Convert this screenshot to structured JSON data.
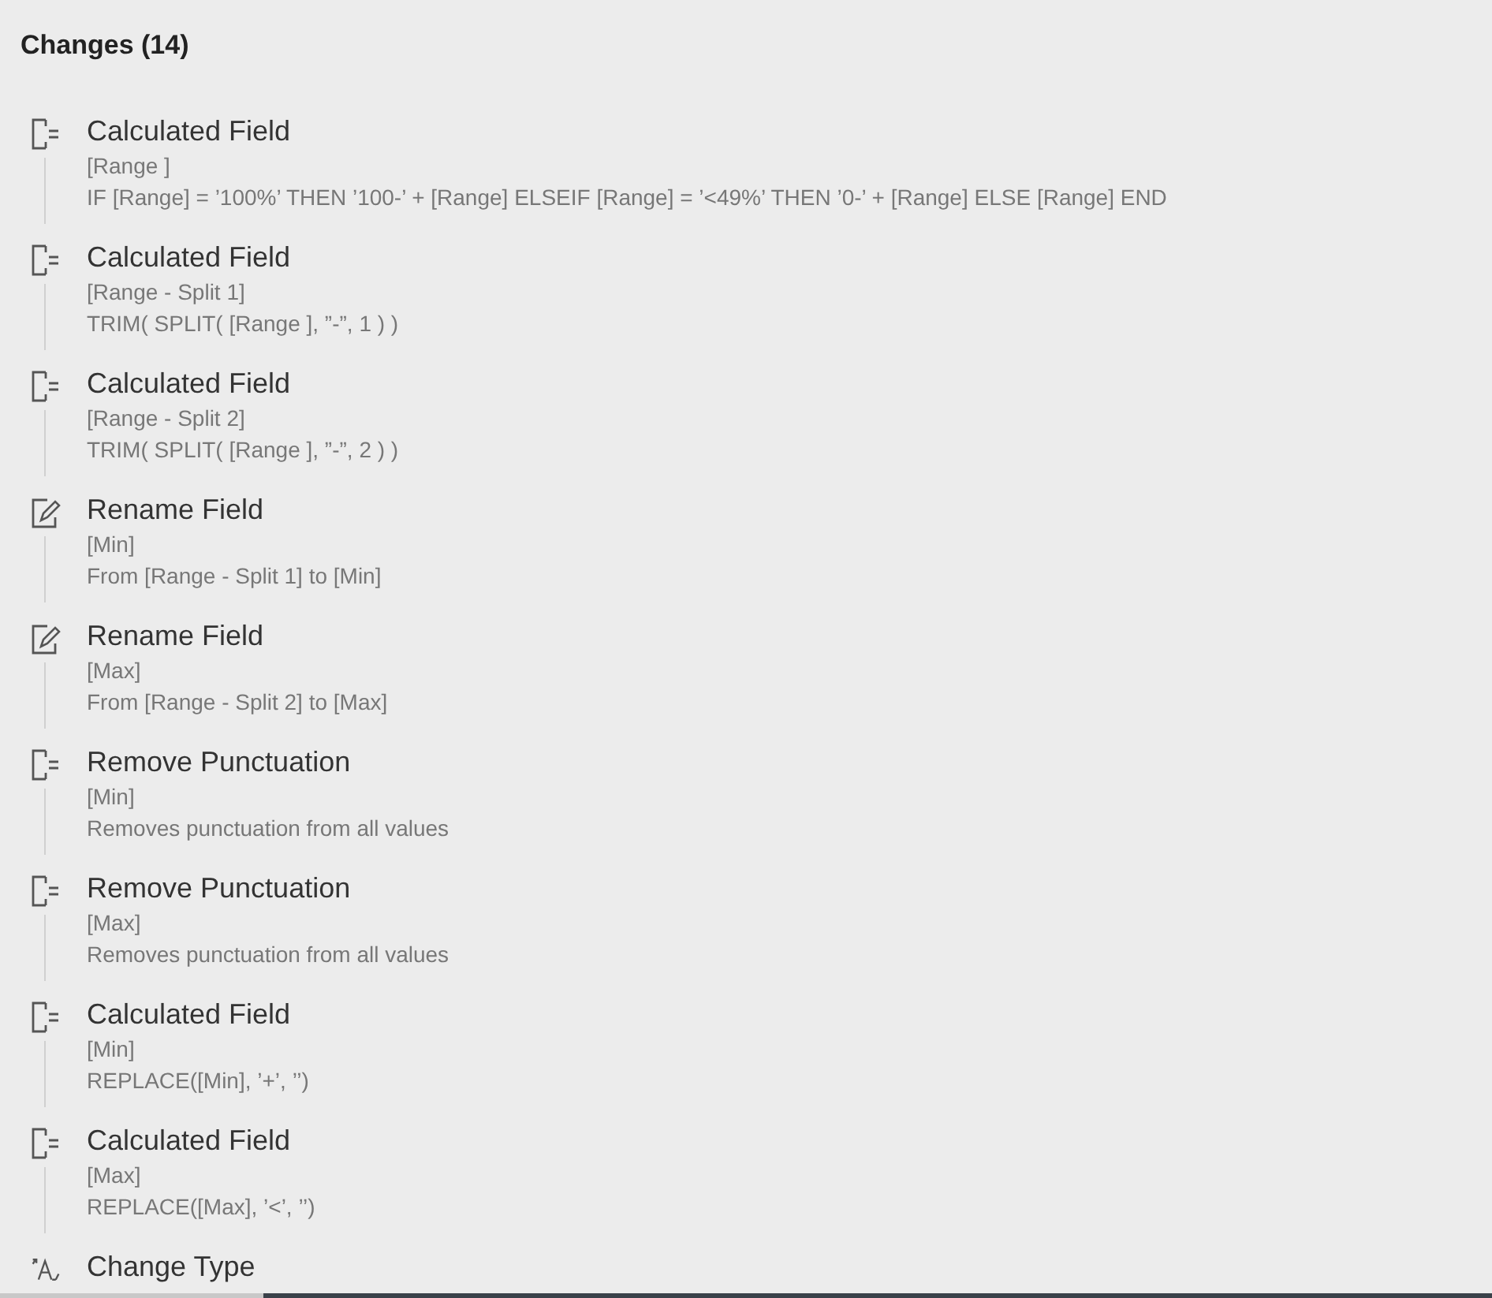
{
  "header": {
    "title": "Changes (14)"
  },
  "changes": [
    {
      "kind": "calc",
      "title": "Calculated Field",
      "field": "[Range ]",
      "detail": "IF [Range] = ’100%’ THEN ’100-’ + [Range] ELSEIF [Range] = ’<49%’ THEN ’0-’ + [Range] ELSE [Range] END"
    },
    {
      "kind": "calc",
      "title": "Calculated Field",
      "field": "[Range - Split 1]",
      "detail": "TRIM( SPLIT( [Range ], ”-”, 1 ) )"
    },
    {
      "kind": "calc",
      "title": "Calculated Field",
      "field": "[Range - Split 2]",
      "detail": "TRIM( SPLIT( [Range ], ”-”, 2 ) )"
    },
    {
      "kind": "rename",
      "title": "Rename Field",
      "field": "[Min]",
      "detail": "From [Range - Split 1] to [Min]"
    },
    {
      "kind": "rename",
      "title": "Rename Field",
      "field": "[Max]",
      "detail": "From [Range - Split 2] to [Max]"
    },
    {
      "kind": "calc",
      "title": "Remove Punctuation",
      "field": "[Min]",
      "detail": "Removes punctuation from all values"
    },
    {
      "kind": "calc",
      "title": "Remove Punctuation",
      "field": "[Max]",
      "detail": "Removes punctuation from all values"
    },
    {
      "kind": "calc",
      "title": "Calculated Field",
      "field": "[Min]",
      "detail": "REPLACE([Min], ’+’, ’’)"
    },
    {
      "kind": "calc",
      "title": "Calculated Field",
      "field": "[Max]",
      "detail": "REPLACE([Max], ’<’, ’’)"
    },
    {
      "kind": "type",
      "title": "Change Type"
    }
  ]
}
